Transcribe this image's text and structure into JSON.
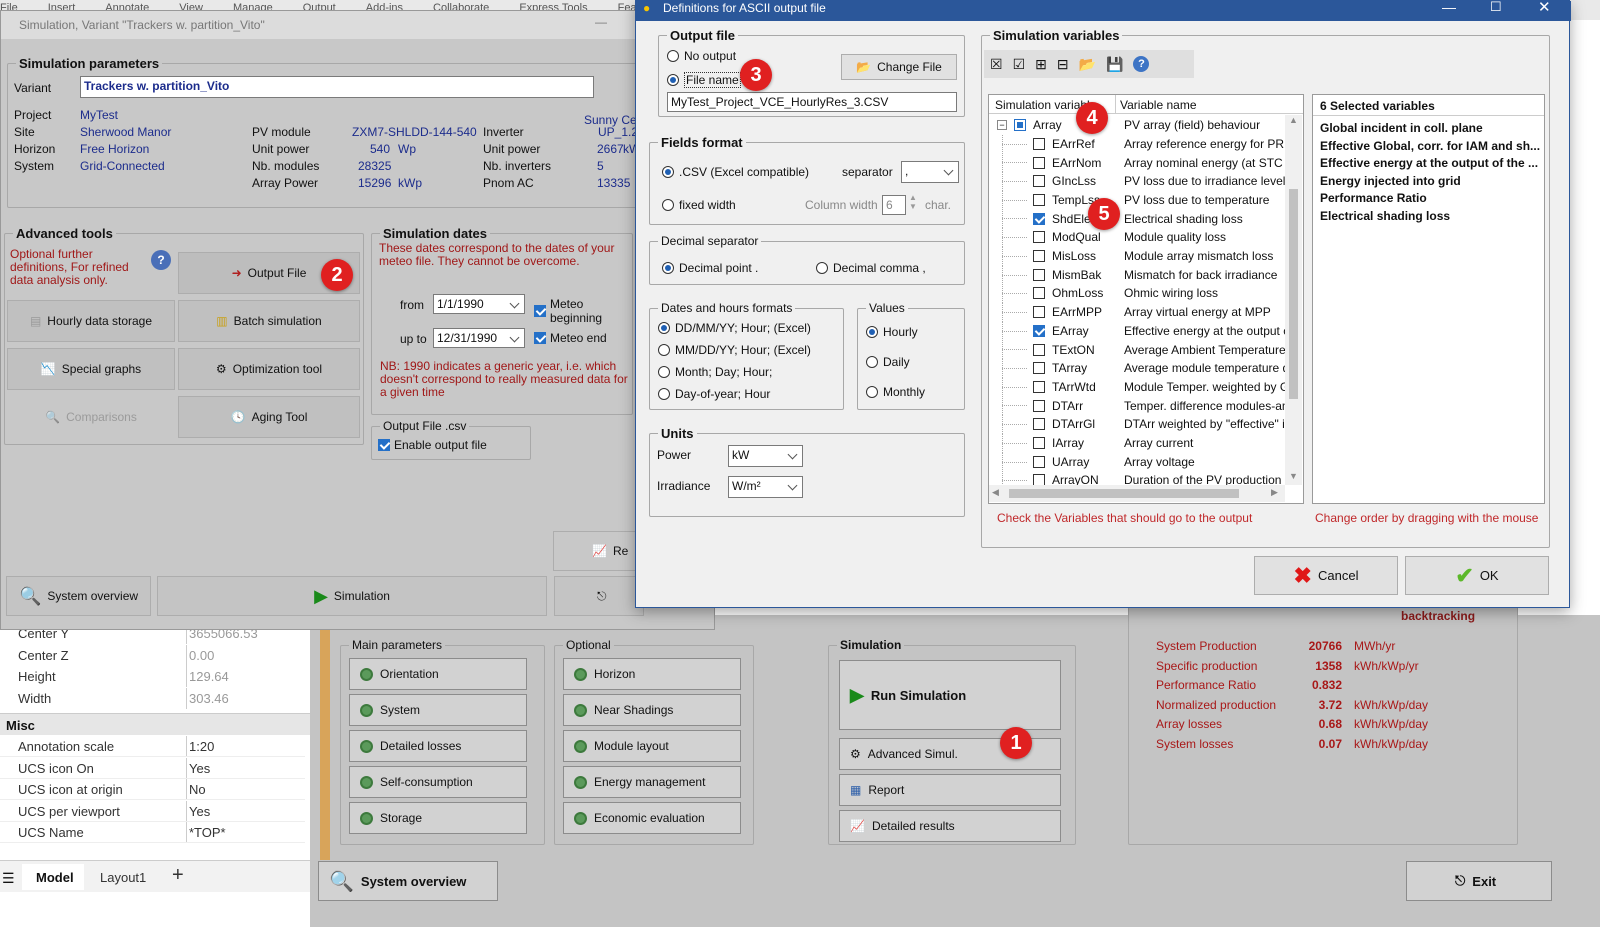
{
  "ribbon": [
    "File",
    "Insert",
    "Annotate",
    "View",
    "Manage",
    "Output",
    "Add-ins",
    "Collaborate",
    "Express Tools",
    "Featured Apps"
  ],
  "sim_window": {
    "title": "Simulation, Variant  \"Trackers w. partition_Vito\"",
    "sim_params_title": "Simulation parameters",
    "variant_label": "Variant",
    "variant_value": "Trackers w. partition_Vito",
    "project_label": "Project",
    "project_value": "MyTest",
    "site_label": "Site",
    "site_value": "Sherwood Manor",
    "horizon_label": "Horizon",
    "horizon_value": "Free Horizon",
    "system_label": "System",
    "system_value": "Grid-Connected",
    "pv_module_label": "PV module",
    "pv_module_value": "ZXM7-SHLDD-144-540",
    "unit_power_label": "Unit power",
    "unit_power_value": "540",
    "unit_power_unit": "Wp",
    "nb_modules_label": "Nb. modules",
    "nb_modules_value": "28325",
    "array_power_label": "Array Power",
    "array_power_value": "15296",
    "array_power_unit": "kWp",
    "inverter_label": "Inverter",
    "inverter_value": "UP_1.2",
    "inv_unit_power_label": "Unit power",
    "inv_unit_power_value": "2667",
    "inv_unit_power_unit": "kW",
    "nb_inverters_label": "Nb. inverters",
    "nb_inverters_value": "5",
    "pnom_label": "Pnom AC",
    "pnom_value": "13335",
    "pnom_unit": "kW",
    "brand": "Sunny Cen",
    "adv_tools_title": "Advanced tools",
    "adv_note": "Optional further definitions, For refined data analysis only.",
    "output_file_btn": "Output File",
    "hourly_btn": "Hourly data storage",
    "batch_btn": "Batch simulation",
    "special_btn": "Special graphs",
    "optim_btn": "Optimization tool",
    "compare_btn": "Comparisons",
    "aging_btn": "Aging Tool",
    "sim_dates_title": "Simulation dates",
    "dates_note": "These dates correspond to the dates of your meteo file. They cannot be overcome.",
    "from_label": "from",
    "from_value": "1/1/1990",
    "meteo_begin": "Meteo beginning",
    "upto_label": "up to",
    "upto_value": "12/31/1990",
    "meteo_end": "Meteo end",
    "nb_note": "NB: 1990 indicates a generic year, i.e. which doesn't correspond to really measured data for a given time",
    "output_csv_title": "Output File .csv",
    "enable_output": "Enable output file",
    "system_overview_btn": "System overview",
    "simulation_btn": "Simulation",
    "re_btn": "Re"
  },
  "properties": {
    "rows": [
      {
        "k": "Center Y",
        "v": "3655066.53"
      },
      {
        "k": "Center Z",
        "v": "0.00"
      },
      {
        "k": "Height",
        "v": "129.64"
      },
      {
        "k": "Width",
        "v": "303.46"
      }
    ],
    "misc_title": "Misc",
    "misc_rows": [
      {
        "k": "Annotation scale",
        "v": "1:20"
      },
      {
        "k": "UCS icon On",
        "v": "Yes"
      },
      {
        "k": "UCS icon at origin",
        "v": "No"
      },
      {
        "k": "UCS per viewport",
        "v": "Yes"
      },
      {
        "k": "UCS Name",
        "v": "*TOP*"
      }
    ],
    "tabs": [
      "Model",
      "Layout1"
    ]
  },
  "main": {
    "main_params_title": "Main parameters",
    "main_params": [
      "Orientation",
      "System",
      "Detailed losses",
      "Self-consumption",
      "Storage"
    ],
    "optional_title": "Optional",
    "optional": [
      "Horizon",
      "Near Shadings",
      "Module layout",
      "Energy management",
      "Economic evaluation"
    ],
    "simulation_title": "Simulation",
    "run_btn": "Run Simulation",
    "adv_simul_btn": "Advanced Simul.",
    "report_btn": "Report",
    "detailed_btn": "Detailed results",
    "backtracking": "backtracking",
    "results": [
      {
        "k": "System Production",
        "v": "20766",
        "u": "MWh/yr"
      },
      {
        "k": "Specific production",
        "v": "1358",
        "u": "kWh/kWp/yr"
      },
      {
        "k": "Performance Ratio",
        "v": "0.832",
        "u": ""
      },
      {
        "k": "Normalized production",
        "v": "3.72",
        "u": "kWh/kWp/day"
      },
      {
        "k": "Array losses",
        "v": "0.68",
        "u": "kWh/kWp/day"
      },
      {
        "k": "System losses",
        "v": "0.07",
        "u": "kWh/kWp/day"
      }
    ],
    "sys_overview_btn": "System overview",
    "exit_btn": "Exit"
  },
  "dialog": {
    "title": "Definitions for ASCII output file",
    "output_file_title": "Output file",
    "no_output": "No output",
    "file_name": "File name",
    "change_file": "Change File",
    "file_value": "MyTest_Project_VCE_HourlyRes_3.CSV",
    "fields_title": "Fields format",
    "csv_opt": ".CSV (Excel compatible)",
    "separator_label": "separator",
    "separator_value": ",",
    "fixed_opt": "fixed width",
    "col_width_label": "Column width",
    "col_width_value": "6",
    "char_label": "char.",
    "decimal_title": "Decimal separator",
    "dec_point": "Decimal point .",
    "dec_comma": "Decimal comma ,",
    "dates_title": "Dates and hours formats",
    "date_opts": [
      "DD/MM/YY; Hour;  (Excel)",
      "MM/DD/YY; Hour;  (Excel)",
      "Month; Day; Hour;",
      "Day-of-year; Hour"
    ],
    "values_title": "Values",
    "value_opts": [
      "Hourly",
      "Daily",
      "Monthly"
    ],
    "units_title": "Units",
    "power_label": "Power",
    "power_value": "kW",
    "irr_label": "Irradiance",
    "irr_value": "W/m²",
    "simvars_title": "Simulation variables",
    "col_var": "Simulation variable",
    "col_name": "Variable name",
    "root_var": "Array",
    "root_name": "PV array (field) behaviour",
    "variables": [
      {
        "v": "EArrRef",
        "n": "Array reference energy for PR"
      },
      {
        "v": "EArrNom",
        "n": "Array nominal energy (at STC ef"
      },
      {
        "v": "GIncLss",
        "n": "PV loss due to irradiance level"
      },
      {
        "v": "TempLss",
        "n": "PV loss due to temperature"
      },
      {
        "v": "ShdElec",
        "n": "Electrical shading loss"
      },
      {
        "v": "ModQual",
        "n": "Module quality loss"
      },
      {
        "v": "MisLoss",
        "n": "Module array mismatch loss"
      },
      {
        "v": "MismBak",
        "n": "Mismatch for back irradiance"
      },
      {
        "v": "OhmLoss",
        "n": "Ohmic wiring loss"
      },
      {
        "v": "EArrMPP",
        "n": "Array virtual energy at MPP"
      },
      {
        "v": "EArray",
        "n": "Effective energy at the output c"
      },
      {
        "v": "TExtON",
        "n": "Average Ambient Temperature c"
      },
      {
        "v": "TArray",
        "n": "Average module temperature du"
      },
      {
        "v": "TArrWtd",
        "n": "Module Temper. weighted by Glc"
      },
      {
        "v": "DTArr",
        "n": "Temper. difference modules-amb"
      },
      {
        "v": "DTArrGl",
        "n": "DTArr weighted by \"effective\" in"
      },
      {
        "v": "IArray",
        "n": "Array current"
      },
      {
        "v": "UArray",
        "n": "Array voltage"
      },
      {
        "v": "ArrayON",
        "n": "Duration of the PV production of"
      }
    ],
    "checked": [
      false,
      false,
      false,
      false,
      true,
      false,
      false,
      false,
      false,
      false,
      true,
      false,
      false,
      false,
      false,
      false,
      false,
      false,
      false
    ],
    "selected_title": "6 Selected variables",
    "selected": [
      "Global incident in coll. plane",
      "Effective Global, corr. for IAM and sh...",
      "Effective energy at the output of the ...",
      "Energy injected into grid",
      "Performance Ratio",
      "Electrical shading loss"
    ],
    "check_note": "Check the Variables that should go to the output",
    "order_note": "Change order by dragging with the mouse",
    "cancel": "Cancel",
    "ok": "OK"
  },
  "badges": [
    "1",
    "2",
    "3",
    "4",
    "5"
  ]
}
